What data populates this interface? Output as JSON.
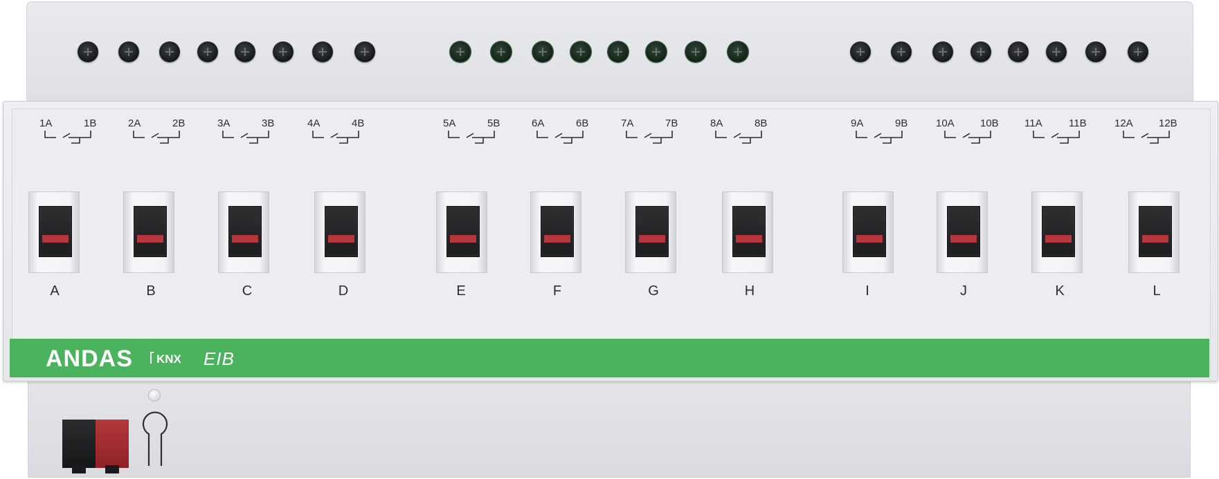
{
  "device": {
    "brand": "ANDAS",
    "knx_logo": "KNX",
    "eib_logo": "EIB"
  },
  "terminals": [
    {
      "a": "1A",
      "b": "1B"
    },
    {
      "a": "2A",
      "b": "2B"
    },
    {
      "a": "3A",
      "b": "3B"
    },
    {
      "a": "4A",
      "b": "4B"
    },
    {
      "a": "5A",
      "b": "5B"
    },
    {
      "a": "6A",
      "b": "6B"
    },
    {
      "a": "7A",
      "b": "7B"
    },
    {
      "a": "8A",
      "b": "8B"
    },
    {
      "a": "9A",
      "b": "9B"
    },
    {
      "a": "10A",
      "b": "10B"
    },
    {
      "a": "11A",
      "b": "11B"
    },
    {
      "a": "12A",
      "b": "12B"
    }
  ],
  "channels": [
    "A",
    "B",
    "C",
    "D",
    "E",
    "F",
    "G",
    "H",
    "I",
    "J",
    "K",
    "L"
  ],
  "colors": {
    "brand_stripe": "#4bb35e",
    "switch_indicator": "#b5363c",
    "bus_connector_positive": "#a32d32",
    "bus_connector_negative": "#1e1f21"
  }
}
